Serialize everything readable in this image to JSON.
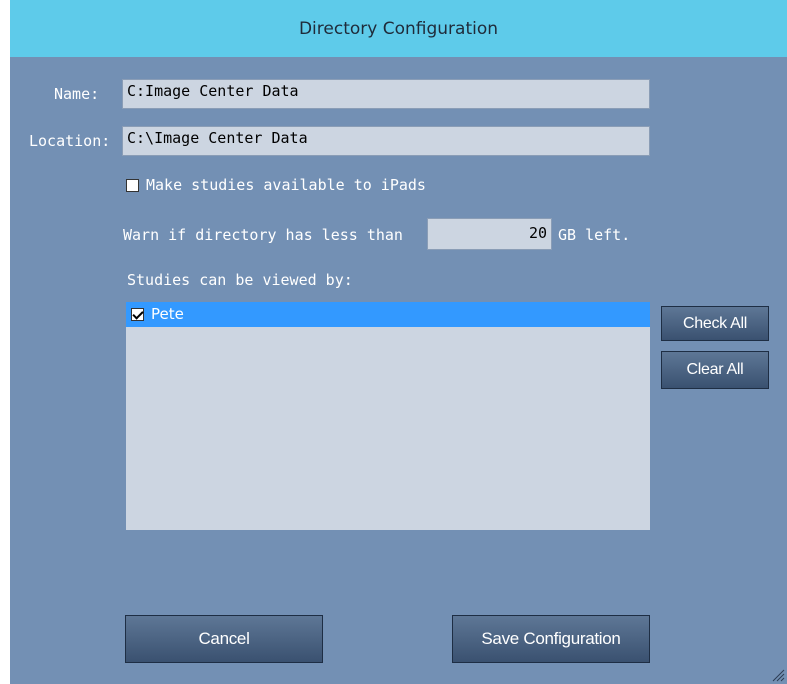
{
  "window": {
    "title": "Directory Configuration"
  },
  "form": {
    "name_label": "Name:",
    "name_value": "C:Image Center Data",
    "location_label": "Location:",
    "location_value": "C:\\Image Center Data",
    "ipads_label": "Make studies available to iPads",
    "ipads_checked": false,
    "warn_label": "Warn if directory has less than",
    "warn_value": "20",
    "warn_unit": "GB left.",
    "viewers_label": "Studies can be viewed by:"
  },
  "viewers": [
    {
      "name": "Pete",
      "checked": true,
      "selected": true
    }
  ],
  "buttons": {
    "check_all": "Check All",
    "clear_all": "Clear All",
    "cancel": "Cancel",
    "save": "Save Configuration"
  }
}
